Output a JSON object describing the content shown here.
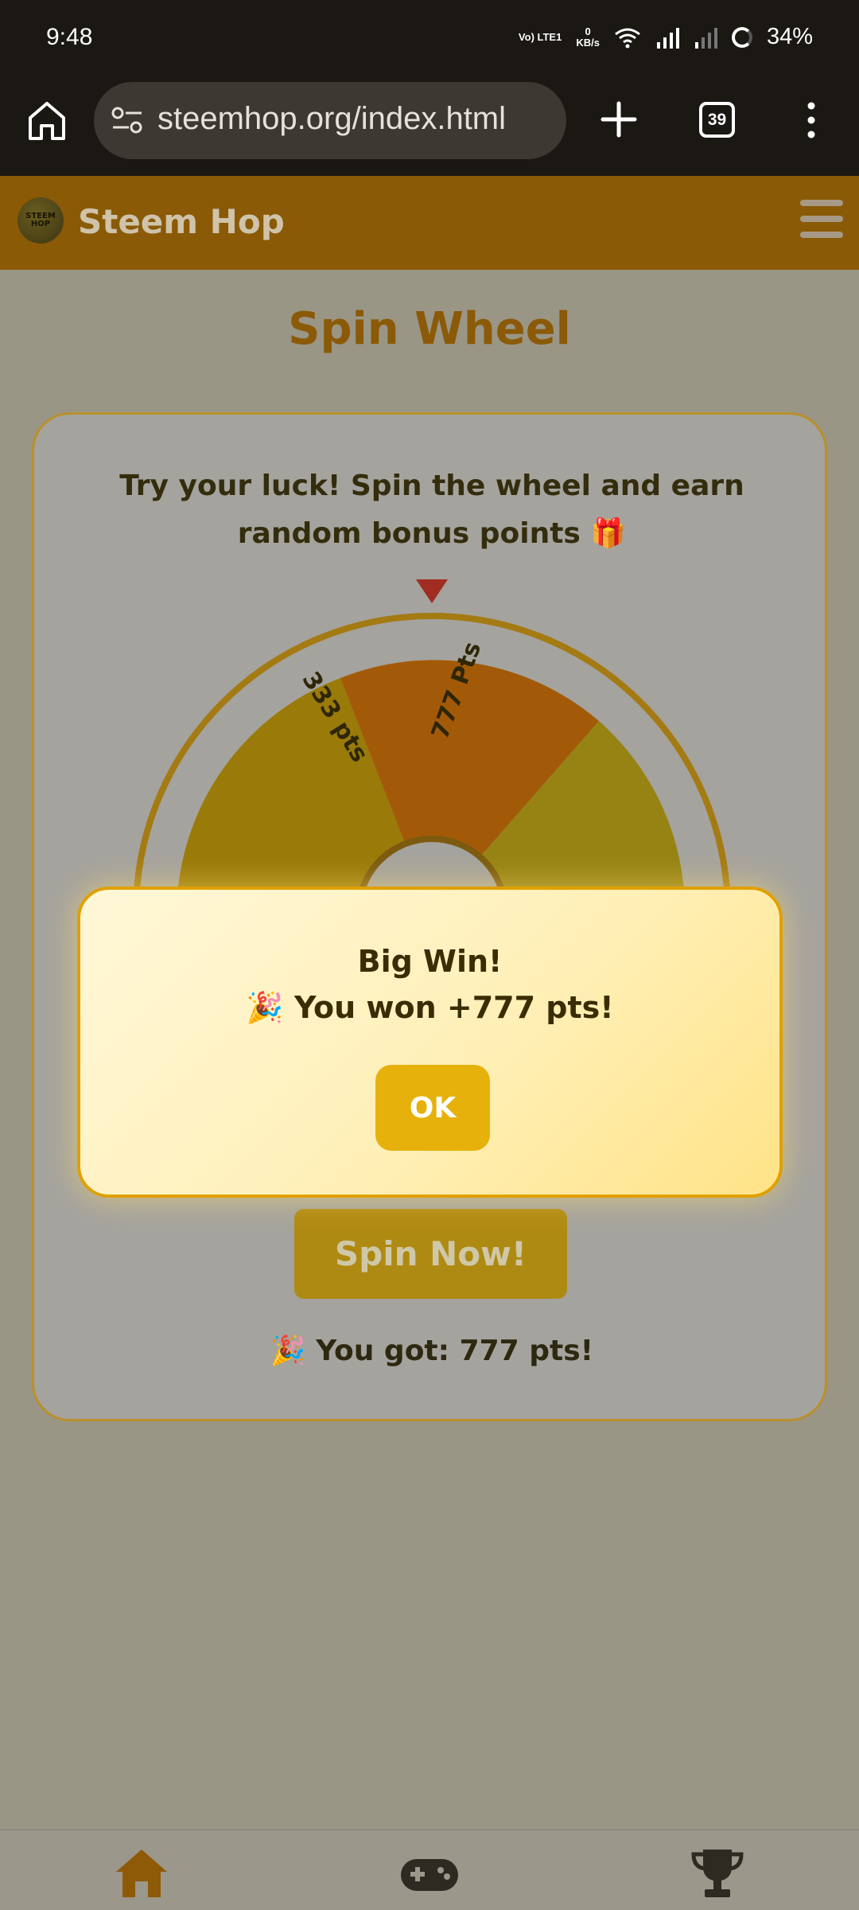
{
  "status_bar": {
    "time": "9:48",
    "network": "Vo) LTE1",
    "data_rate_value": "0",
    "data_rate_unit": "KB/s",
    "battery": "34%"
  },
  "browser": {
    "url": "steemhop.org/index.html",
    "tab_count": "39"
  },
  "site": {
    "logo_text": "STEEM HOP",
    "name": "Steem Hop"
  },
  "page": {
    "title": "Spin Wheel",
    "intro_line1": "Try your luck! Spin the wheel and earn",
    "intro_line2": "random bonus points 🎁",
    "wheel_labels": [
      "333 pts",
      "777 Pts"
    ],
    "spin_button": "Spin Now!",
    "result": "🎉 You got: 777 pts!"
  },
  "modal": {
    "title": "Big Win!",
    "message": "🎉 You won +777 pts!",
    "ok": "OK"
  },
  "colors": {
    "header": "#8a5a06",
    "modal_border": "#e0a000",
    "ok_button": "#e6b10a",
    "title": "#8b5a08"
  }
}
